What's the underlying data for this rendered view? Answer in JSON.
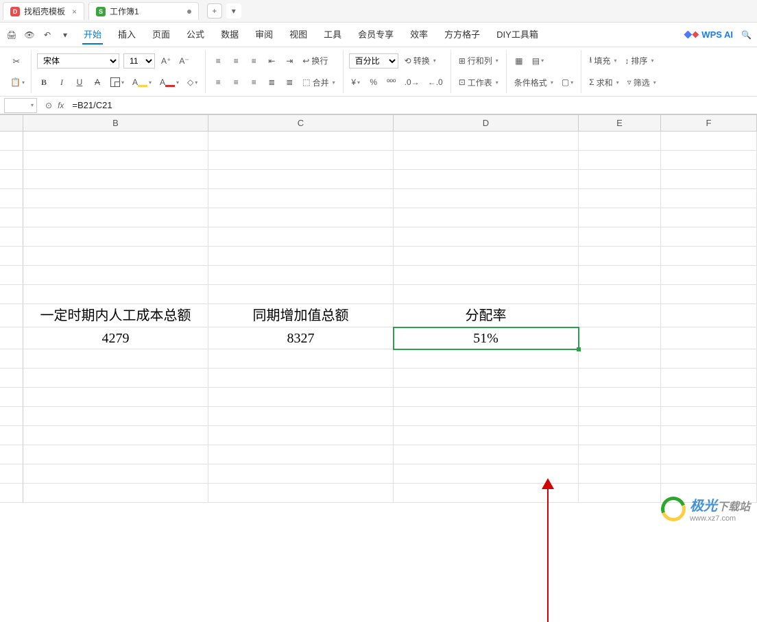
{
  "tabs": {
    "t1": "找稻壳模板",
    "t2": "工作簿1",
    "add": "+"
  },
  "menu": {
    "items": [
      "开始",
      "插入",
      "页面",
      "公式",
      "数据",
      "审阅",
      "视图",
      "工具",
      "会员专享",
      "效率",
      "方方格子",
      "DIY工具箱"
    ]
  },
  "wpsai": "WPS AI",
  "ribbon": {
    "font_name": "宋体",
    "font_size": "11",
    "A_plus": "A⁺",
    "A_minus": "A⁻",
    "B": "B",
    "I": "I",
    "U": "U",
    "S": "A",
    "numfmt": "百分比",
    "convert": "转换",
    "rowcol": "行和列",
    "worksheet": "工作表",
    "condfmt": "条件格式",
    "wrap": "换行",
    "merge": "合并",
    "fill": "填充",
    "sort": "排序",
    "sum": "求和",
    "filter": "筛选"
  },
  "formula_bar": {
    "formula": "=B21/C21"
  },
  "columns": [
    "B",
    "C",
    "D",
    "E",
    "F"
  ],
  "data": {
    "headers": {
      "B": "一定时期内人工成本总额",
      "C": "同期增加值总额",
      "D": "分配率"
    },
    "values": {
      "B": "4279",
      "C": "8327",
      "D": "51%"
    }
  },
  "watermark": {
    "t1": "极光",
    "t2": "下载站",
    "url": "www.xz7.com"
  }
}
